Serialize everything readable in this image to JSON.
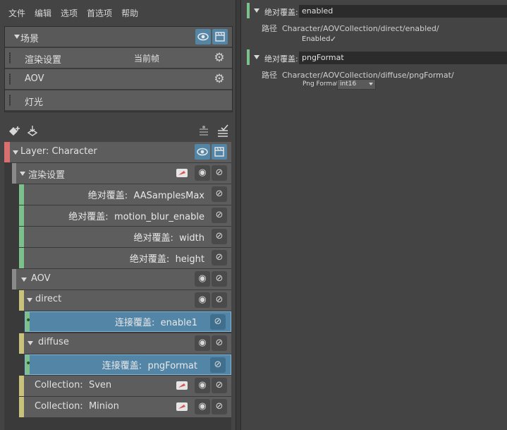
{
  "menu": [
    "文件",
    "编辑",
    "选项",
    "首选项",
    "帮助"
  ],
  "scene": {
    "title": "场景",
    "rows": [
      {
        "label": "渲染设置",
        "value": "当前帧"
      },
      {
        "label": "AOV",
        "value": ""
      },
      {
        "label": "灯光",
        "value": ""
      }
    ]
  },
  "tree": {
    "layer": "Layer:   Character",
    "render_settings": "渲染设置",
    "overrides": [
      {
        "prefix": "绝对覆盖:",
        "name": "AASamplesMax"
      },
      {
        "prefix": "绝对覆盖:",
        "name": "motion_blur_enable"
      },
      {
        "prefix": "绝对覆盖:",
        "name": "width"
      },
      {
        "prefix": "绝对覆盖:",
        "name": "height"
      }
    ],
    "aov": "AOV",
    "direct": "direct",
    "direct_override": {
      "prefix": "连接覆盖:",
      "name": "enable1"
    },
    "diffuse": "diffuse",
    "diffuse_override": {
      "prefix": "连接覆盖:",
      "name": "pngFormat"
    },
    "collections": [
      {
        "prefix": "Collection:",
        "name": "Sven"
      },
      {
        "prefix": "Collection:",
        "name": "Minion"
      }
    ]
  },
  "right": {
    "block1": {
      "label": "绝对覆盖:",
      "value": "enabled",
      "path_label": "路径",
      "path": "Character/AOVCollection/direct/enabled/",
      "attr_label": "Enabled",
      "checked": "✓"
    },
    "block2": {
      "label": "绝对覆盖:",
      "value": "pngFormat",
      "path_label": "路径",
      "path": "Character/AOVCollection/diffuse/pngFormat/",
      "attr_label": "Png Format",
      "select_value": "int16"
    }
  },
  "colors": {
    "green": "#7cc08b",
    "yellow": "#c8c27a",
    "red": "#d9706f",
    "blue": "#5285a6"
  }
}
